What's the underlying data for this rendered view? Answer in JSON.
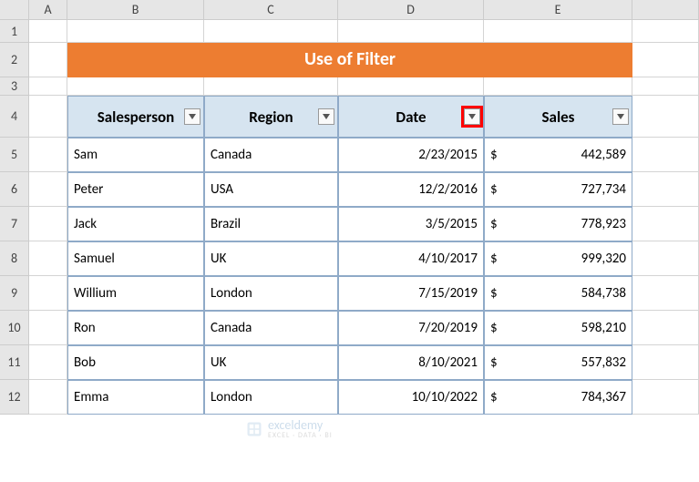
{
  "columns": [
    "A",
    "B",
    "C",
    "D",
    "E"
  ],
  "rows": [
    "1",
    "2",
    "3",
    "4",
    "5",
    "6",
    "7",
    "8",
    "9",
    "10",
    "11",
    "12"
  ],
  "title": "Use of Filter",
  "headers": {
    "salesperson": "Salesperson",
    "region": "Region",
    "date": "Date",
    "sales": "Sales"
  },
  "chart_data": {
    "type": "table",
    "columns": [
      "Salesperson",
      "Region",
      "Date",
      "Sales"
    ],
    "rows": [
      {
        "salesperson": "Sam",
        "region": "Canada",
        "date": "2/23/2015",
        "sales": "442,589"
      },
      {
        "salesperson": "Peter",
        "region": "USA",
        "date": "12/2/2016",
        "sales": "727,734"
      },
      {
        "salesperson": "Jack",
        "region": "Brazil",
        "date": "3/5/2015",
        "sales": "778,923"
      },
      {
        "salesperson": "Samuel",
        "region": "UK",
        "date": "4/10/2017",
        "sales": "999,320"
      },
      {
        "salesperson": "Willium",
        "region": "London",
        "date": "7/15/2019",
        "sales": "584,738"
      },
      {
        "salesperson": "Ron",
        "region": "Canada",
        "date": "7/20/2019",
        "sales": "598,210"
      },
      {
        "salesperson": "Bob",
        "region": "UK",
        "date": "8/10/2021",
        "sales": "557,832"
      },
      {
        "salesperson": "Emma",
        "region": "London",
        "date": "10/10/2022",
        "sales": "784,367"
      }
    ]
  },
  "currency": "$",
  "watermark": {
    "name": "exceldemy",
    "sub": "EXCEL · DATA · BI"
  }
}
